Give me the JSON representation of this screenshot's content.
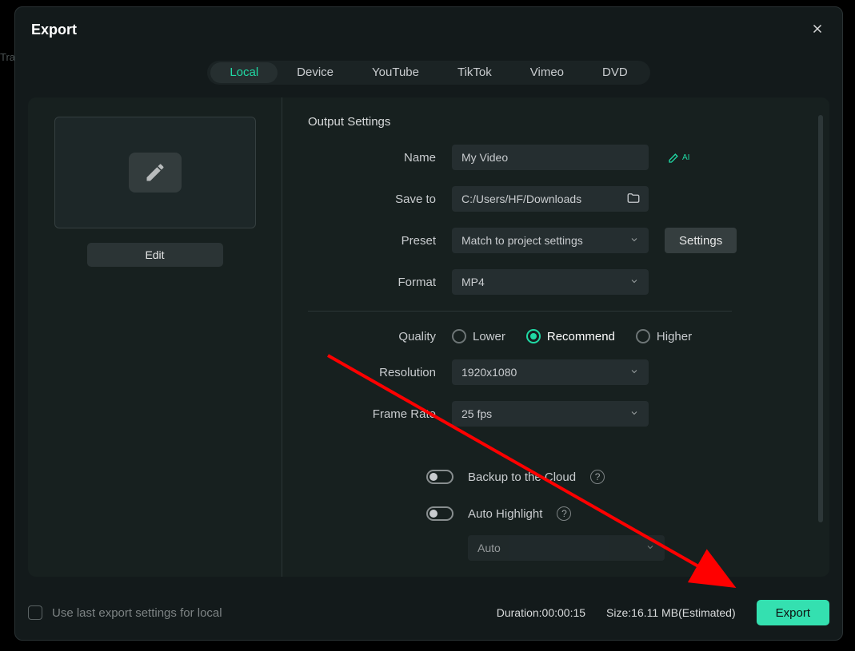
{
  "modal": {
    "title": "Export",
    "close_aria": "Close"
  },
  "tabs": {
    "local": "Local",
    "device": "Device",
    "youtube": "YouTube",
    "tiktok": "TikTok",
    "vimeo": "Vimeo",
    "dvd": "DVD"
  },
  "preview": {
    "edit_label": "Edit"
  },
  "form": {
    "section_title": "Output Settings",
    "name_label": "Name",
    "name_value": "My Video",
    "ai_badge": "AI",
    "save_label": "Save to",
    "save_value": "C:/Users/HF/Downloads",
    "preset_label": "Preset",
    "preset_value": "Match to project settings",
    "settings_label": "Settings",
    "format_label": "Format",
    "format_value": "MP4",
    "quality_label": "Quality",
    "quality_options": {
      "lower": "Lower",
      "recommend": "Recommend",
      "higher": "Higher"
    },
    "quality_selected": "recommend",
    "resolution_label": "Resolution",
    "resolution_value": "1920x1080",
    "framerate_label": "Frame Rate",
    "framerate_value": "25 fps",
    "backup_label": "Backup to the Cloud",
    "highlight_label": "Auto Highlight",
    "highlight_mode_value": "Auto"
  },
  "footer": {
    "uselast_label": "Use last export settings for local",
    "duration_label": "Duration:",
    "duration_value": "00:00:15",
    "size_label": "Size:",
    "size_value": "16.11 MB",
    "size_suffix": "(Estimated)",
    "export_label": "Export"
  },
  "bg": {
    "tra": "Tra"
  }
}
